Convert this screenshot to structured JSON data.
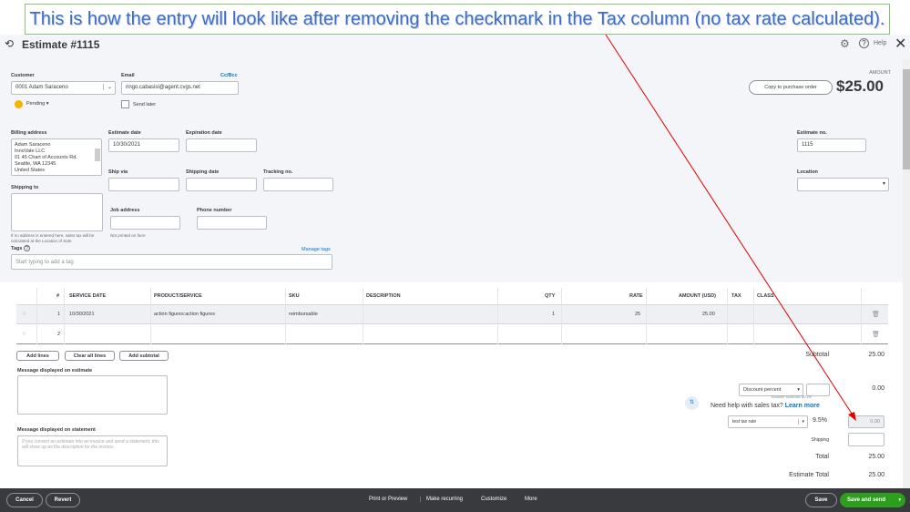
{
  "callout": "This is how the entry will look like after removing the checkmark in the Tax column (no tax rate calculated).",
  "header": {
    "title": "Estimate #1115",
    "help": "Help"
  },
  "customer": {
    "label": "Customer",
    "value": "0001 Adam Saraceno",
    "status": "Pending"
  },
  "email": {
    "label": "Email",
    "value": "ringo.cabasisi@agent.cvgs.net",
    "ccbcc": "Cc/Bcc",
    "send_later": "Send later"
  },
  "amount": {
    "label": "AMOUNT",
    "value": "$25.00",
    "copy_button": "Copy to purchase order"
  },
  "billing": {
    "label": "Billing address",
    "lines": [
      "Adam Saraceno",
      "InnoVate LLC",
      "01 45 Chart of Accounts Rd.",
      "Seattle, WA 12345",
      "United States"
    ]
  },
  "estimate_date": {
    "label": "Estimate date",
    "value": "10/30/2021"
  },
  "expiration_date": {
    "label": "Expiration date",
    "value": ""
  },
  "estimate_no": {
    "label": "Estimate no.",
    "value": "1115"
  },
  "ship_via": {
    "label": "Ship via"
  },
  "shipping_date": {
    "label": "Shipping date"
  },
  "tracking_no": {
    "label": "Tracking no."
  },
  "location": {
    "label": "Location"
  },
  "shipping_to": {
    "label": "Shipping to",
    "note": "If no address is entered here, sales tax will be calculated at the Location of Sale."
  },
  "job_address": {
    "label": "Job address",
    "note": "Not printed on form"
  },
  "phone": {
    "label": "Phone number"
  },
  "tags": {
    "label": "Tags",
    "manage": "Manage tags",
    "placeholder": "Start typing to add a tag"
  },
  "table": {
    "headers": [
      "#",
      "SERVICE DATE",
      "PRODUCT/SERVICE",
      "SKU",
      "DESCRIPTION",
      "QTY",
      "RATE",
      "AMOUNT (USD)",
      "TAX",
      "CLASS"
    ],
    "rows": [
      {
        "num": "1",
        "date": "10/30/2021",
        "product": "action figures:action figures",
        "sku": "reimbursable",
        "description": "",
        "qty": "1",
        "rate": "25",
        "amount": "25.00"
      },
      {
        "num": "2"
      }
    ]
  },
  "line_buttons": {
    "add": "Add lines",
    "clear": "Clear all lines",
    "subtotal": "Add subtotal"
  },
  "messages": {
    "estimate_label": "Message displayed on estimate",
    "statement_label": "Message displayed on statement",
    "statement_placeholder": "If you convert an estimate into an invoice and send a statement, this will show up as the description for the invoice."
  },
  "totals": {
    "subtotal_label": "Subtotal",
    "subtotal": "25.00",
    "discount_type": "Discount percent",
    "discount": "0.00",
    "taxable_subtotal": "Taxable subtotal $0.00",
    "help_text": "Need help with sales tax?",
    "learn_more": "Learn more",
    "tax_rate": "test tax rate",
    "tax_percent": "9.5%",
    "tax_amount": "0.00",
    "shipping_label": "Shipping",
    "total_label": "Total",
    "total": "25.00",
    "estimate_total_label": "Estimate Total",
    "estimate_total": "25.00"
  },
  "footer": {
    "cancel": "Cancel",
    "revert": "Revert",
    "print": "Print or Preview",
    "recurring": "Make recurring",
    "customize": "Customize",
    "more": "More",
    "save": "Save",
    "save_send": "Save and send"
  },
  "colors": {
    "accent": "#2ca01c",
    "link": "#0077c5",
    "arrow": "#e00000",
    "footer": "#393a3d"
  }
}
